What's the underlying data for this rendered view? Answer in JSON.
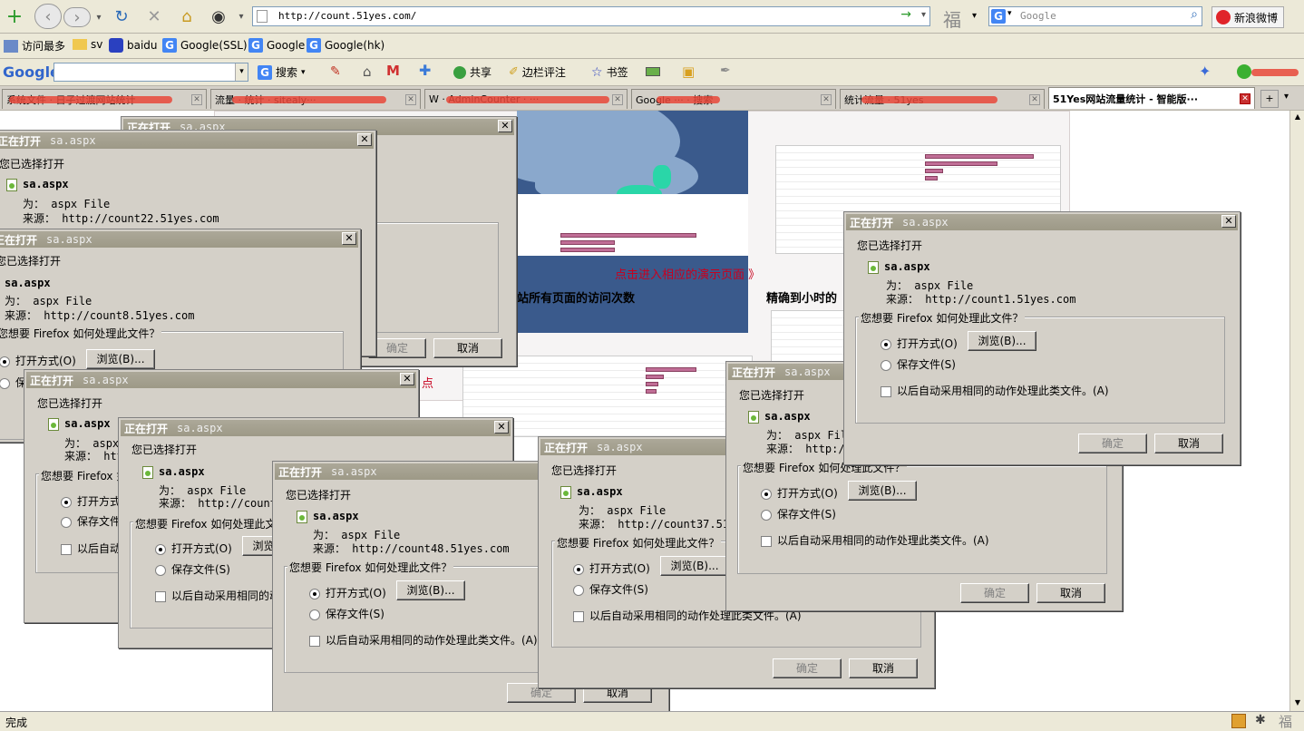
{
  "browser": {
    "url": "http://count.51yes.com/",
    "search_placeholder": "Google",
    "weibo_label": "新浪微博",
    "fu_char": "福"
  },
  "bookmarks": [
    {
      "label": "访问最多"
    },
    {
      "label": "sv"
    },
    {
      "label": "baidu"
    },
    {
      "label": "Google(SSL)"
    },
    {
      "label": "Google"
    },
    {
      "label": "Google(hk)"
    }
  ],
  "google_toolbar": {
    "logo": "Google",
    "search_label": "搜索",
    "share_label": "共享",
    "sidewiki_label": "边栏评注",
    "bookmarks_label": "书签"
  },
  "tabs": [
    {
      "label": "系统文件 · 日子过渡网站统计"
    },
    {
      "label": "流量 · 统计 · sitealy···"
    },
    {
      "label": "W · AdminCounter · ···"
    },
    {
      "label": "Google ··· · 搜索"
    },
    {
      "label": "统计流量 · 51yes"
    },
    {
      "label": "51Yes网站流量统计 - 智能版···"
    }
  ],
  "page": {
    "demo_link": "点击进入相应的演示页面 》",
    "heading_pages": "站所有页面的访问次数",
    "heading_hours": "精确到小时的",
    "red_char": "点"
  },
  "status": {
    "text": "完成"
  },
  "dialog_common": {
    "title": "正在打开",
    "chosen_open": "您已选择打开",
    "type_prefix": "为：",
    "type_value": "aspx File",
    "from_prefix": "来源：",
    "question": "您想要 Firefox 如何处理此文件？",
    "open_with": "打开方式(O)",
    "browse": "浏览(B)...",
    "save_file": "保存文件(S)",
    "auto_action": "以后自动采用相同的动作处理此类文件。(A)",
    "ok": "确定",
    "cancel": "取消"
  },
  "dialogs": [
    {
      "filename": "sa.aspx",
      "source": "http://count22.51yes.com"
    },
    {
      "filename": "sa.aspx",
      "source": "http://count8.51yes.com"
    },
    {
      "filename": "sa.aspx",
      "source": "htt"
    },
    {
      "filename": "sa.aspx",
      "source": "http://count20"
    },
    {
      "filename": "sa.aspx",
      "source": "http://count48.51yes.com"
    },
    {
      "filename": "sa.aspx",
      "source": "http://count37.51yes"
    },
    {
      "filename": "sa.aspx",
      "source": "http://"
    },
    {
      "filename": "sa.aspx",
      "source": "http://count1.51yes.com"
    }
  ]
}
